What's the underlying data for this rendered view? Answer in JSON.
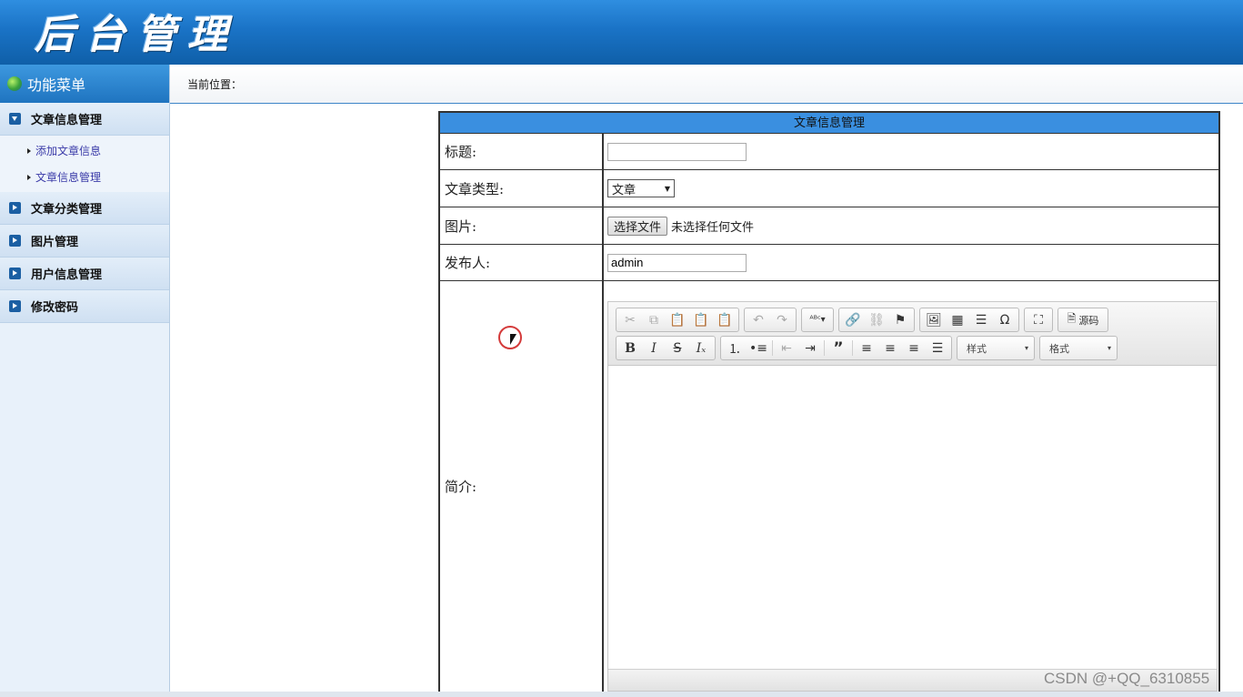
{
  "header": {
    "logo_text": "后台管理"
  },
  "sidebar": {
    "title": "功能菜单",
    "groups": [
      {
        "label": "文章信息管理",
        "expanded": true,
        "items": [
          {
            "label": "添加文章信息"
          },
          {
            "label": "文章信息管理"
          }
        ]
      },
      {
        "label": "文章分类管理",
        "expanded": false
      },
      {
        "label": "图片管理",
        "expanded": false
      },
      {
        "label": "用户信息管理",
        "expanded": false
      },
      {
        "label": "修改密码",
        "expanded": false
      }
    ]
  },
  "breadcrumb": {
    "label": "当前位置："
  },
  "form": {
    "title": "文章信息管理",
    "fields": {
      "title": {
        "label": "标题:",
        "value": ""
      },
      "type": {
        "label": "文章类型:",
        "value": "文章"
      },
      "image": {
        "label": "图片:",
        "button": "选择文件",
        "status": "未选择任何文件"
      },
      "publisher": {
        "label": "发布人:",
        "value": "admin"
      },
      "intro": {
        "label": "简介:"
      }
    },
    "editor": {
      "source_button": "源码",
      "style_combo": "样式",
      "format_combo": "格式"
    }
  },
  "watermark": "CSDN @+QQ_6310855",
  "colors": {
    "header": "#1a73c6",
    "accent": "#3a8fe0",
    "cursor_ring": "#d43a3a"
  }
}
